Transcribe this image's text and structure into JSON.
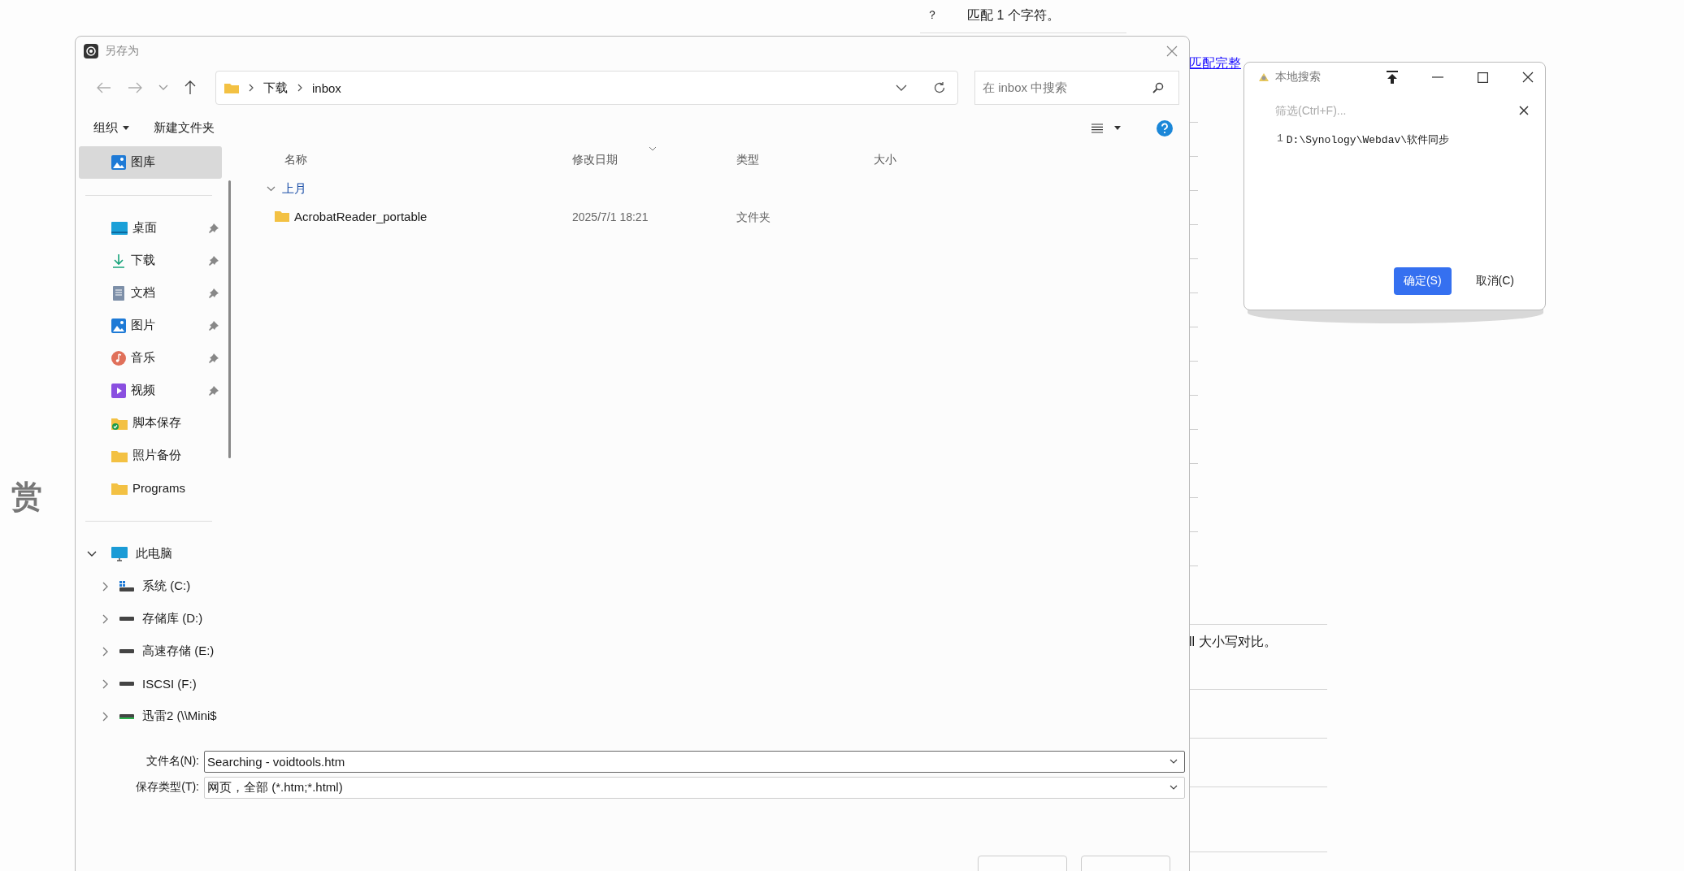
{
  "background_page": {
    "symbol": "？",
    "symbol_text": "匹配 1 个字符。",
    "link": "匹配完整",
    "heading_fragment": "赏",
    "text_fragment": "ll 大小写对比。"
  },
  "save_dialog": {
    "title": "另存为",
    "breadcrumb": [
      "下载",
      "inbox"
    ],
    "search_placeholder": "在 inbox 中搜索",
    "toolbar": [
      {
        "label": "组织",
        "has_menu": true
      },
      {
        "label": "新建文件夹",
        "has_menu": false
      }
    ],
    "sidebar": {
      "top": [
        {
          "label": "图库",
          "kind": "gallery",
          "selected": true
        }
      ],
      "quick_access": [
        {
          "label": "桌面",
          "kind": "desktop",
          "selected": false,
          "pinned": true
        },
        {
          "label": "下载",
          "kind": "download",
          "selected": false,
          "pinned": true
        },
        {
          "label": "文档",
          "kind": "document",
          "selected": false,
          "pinned": true
        },
        {
          "label": "图片",
          "kind": "pictures",
          "selected": false,
          "pinned": true
        },
        {
          "label": "音乐",
          "kind": "music",
          "selected": false,
          "pinned": true
        },
        {
          "label": "视频",
          "kind": "video",
          "selected": false,
          "pinned": true
        },
        {
          "label": "脚本保存",
          "kind": "synced-folder",
          "selected": false,
          "pinned": false
        },
        {
          "label": "照片备份",
          "kind": "folder",
          "selected": false,
          "pinned": false
        },
        {
          "label": "Programs",
          "kind": "folder",
          "selected": false,
          "pinned": false
        }
      ],
      "this_pc": {
        "label": "此电脑",
        "expanded": true,
        "children": [
          {
            "label": "系统 (C:)",
            "kind": "system-drive",
            "expanded": false
          },
          {
            "label": "存储库 (D:)",
            "kind": "drive",
            "expanded": false
          },
          {
            "label": "高速存储 (E:)",
            "kind": "drive",
            "expanded": false
          },
          {
            "label": "ISCSI (F:)",
            "kind": "drive",
            "expanded": false
          },
          {
            "label": "迅雷2 (\\\\Mini$",
            "kind": "network-drive",
            "expanded": false
          }
        ]
      }
    },
    "columns": [
      "名称",
      "修改日期",
      "类型",
      "大小"
    ],
    "groups": [
      {
        "label": "上月",
        "expanded": true,
        "rows": [
          {
            "name": "AcrobatReader_portable",
            "date": "2025/7/1 18:21",
            "type": "文件夹"
          }
        ]
      }
    ],
    "file_name": {
      "label": "文件名(N):",
      "value": "Searching - voidtools.htm"
    },
    "file_type": {
      "label": "保存类型(T):",
      "value": "网页，全部 (*.htm;*.html)"
    }
  },
  "search_popup": {
    "title": "本地搜索",
    "filter_placeholder": "筛选(Ctrl+F)...",
    "results": [
      {
        "index": "1",
        "path": "D:\\Synology\\Webdav\\软件同步"
      }
    ],
    "buttons": [
      {
        "label": "确定(S)",
        "kind": "primary"
      },
      {
        "label": "取消(C)",
        "kind": "secondary"
      }
    ]
  }
}
